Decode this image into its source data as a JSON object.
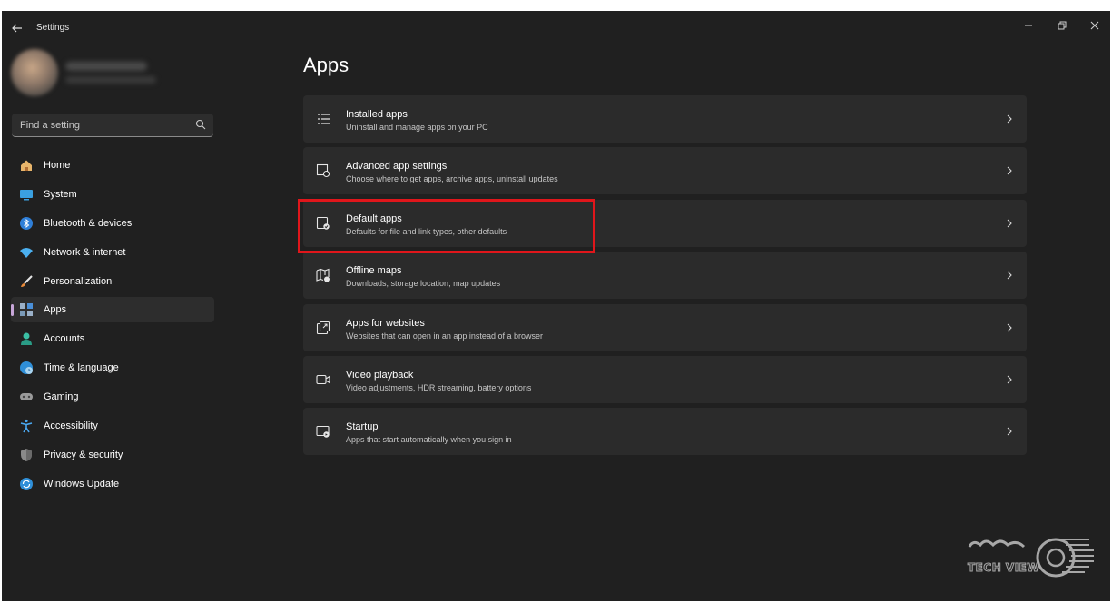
{
  "window": {
    "title": "Settings"
  },
  "search": {
    "placeholder": "Find a setting"
  },
  "nav": {
    "items": [
      {
        "label": "Home",
        "icon": "home-icon"
      },
      {
        "label": "System",
        "icon": "system-icon"
      },
      {
        "label": "Bluetooth & devices",
        "icon": "bluetooth-icon"
      },
      {
        "label": "Network & internet",
        "icon": "wifi-icon"
      },
      {
        "label": "Personalization",
        "icon": "brush-icon"
      },
      {
        "label": "Apps",
        "icon": "apps-icon",
        "active": true
      },
      {
        "label": "Accounts",
        "icon": "accounts-icon"
      },
      {
        "label": "Time & language",
        "icon": "globe-icon"
      },
      {
        "label": "Gaming",
        "icon": "gamepad-icon"
      },
      {
        "label": "Accessibility",
        "icon": "accessibility-icon"
      },
      {
        "label": "Privacy & security",
        "icon": "shield-icon"
      },
      {
        "label": "Windows Update",
        "icon": "update-icon"
      }
    ]
  },
  "main": {
    "title": "Apps",
    "cards": [
      {
        "title": "Installed apps",
        "subtitle": "Uninstall and manage apps on your PC",
        "icon": "installed-apps-icon"
      },
      {
        "title": "Advanced app settings",
        "subtitle": "Choose where to get apps, archive apps, uninstall updates",
        "icon": "advanced-app-settings-icon"
      },
      {
        "title": "Default apps",
        "subtitle": "Defaults for file and link types, other defaults",
        "icon": "default-apps-icon",
        "highlighted": true
      },
      {
        "title": "Offline maps",
        "subtitle": "Downloads, storage location, map updates",
        "icon": "offline-maps-icon"
      },
      {
        "title": "Apps for websites",
        "subtitle": "Websites that can open in an app instead of a browser",
        "icon": "apps-for-websites-icon"
      },
      {
        "title": "Video playback",
        "subtitle": "Video adjustments, HDR streaming, battery options",
        "icon": "video-playback-icon"
      },
      {
        "title": "Startup",
        "subtitle": "Apps that start automatically when you sign in",
        "icon": "startup-icon"
      }
    ]
  },
  "watermark": {
    "text": "TECH VIEW"
  },
  "colors": {
    "background": "#202020",
    "card": "#2b2b2b",
    "accent": "#c7a6d8",
    "highlight": "#e0161b"
  }
}
